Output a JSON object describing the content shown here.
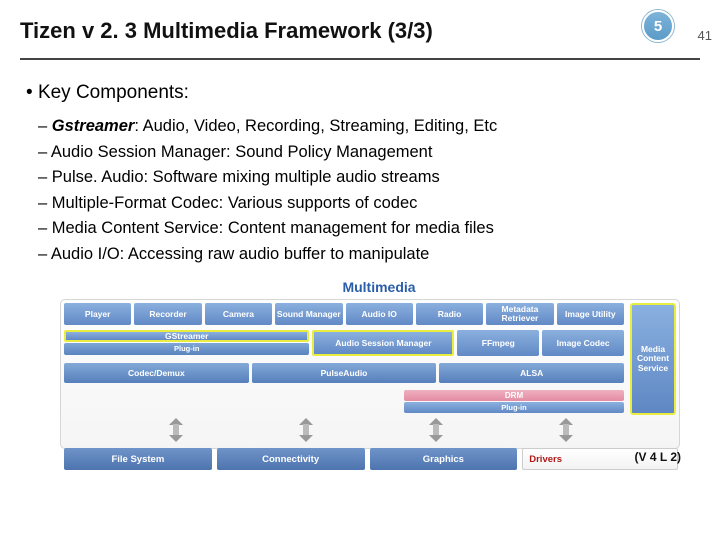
{
  "header": {
    "title": "Tizen v 2. 3 Multimedia Framework (3/3)",
    "badge_small": "5",
    "badge_page": "41"
  },
  "heading": "Key Components:",
  "bullets": [
    {
      "term": "Gstreamer",
      "rest": ": Audio, Video, Recording, Streaming, Editing, Etc"
    },
    {
      "term": "",
      "rest": "Audio Session Manager: Sound Policy Management"
    },
    {
      "term": "",
      "rest": "Pulse. Audio: Software mixing multiple audio streams"
    },
    {
      "term": "",
      "rest": "Multiple-Format Codec: Various supports of codec"
    },
    {
      "term": "",
      "rest": "Media Content Service: Content management for media files"
    },
    {
      "term": "",
      "rest": "Audio I/O: Accessing raw audio buffer to manipulate"
    }
  ],
  "diagram": {
    "title": "Multimedia",
    "side": "Media Content Service",
    "row1": [
      "Player",
      "Recorder",
      "Camera",
      "Sound Manager",
      "Audio IO",
      "Radio",
      "Metadata Retriever",
      "Image Utility"
    ],
    "gs": "GStreamer",
    "plugin": "Plug-in",
    "asm": "Audio Session Manager",
    "ffm": "FFmpeg",
    "imgc": "Image Codec",
    "row3": [
      "Codec/Demux",
      "PulseAudio",
      "ALSA"
    ],
    "drm": "DRM",
    "footer": [
      "File System",
      "Connectivity",
      "Graphics",
      "Drivers"
    ],
    "v4l2": "(V 4 L 2)"
  }
}
